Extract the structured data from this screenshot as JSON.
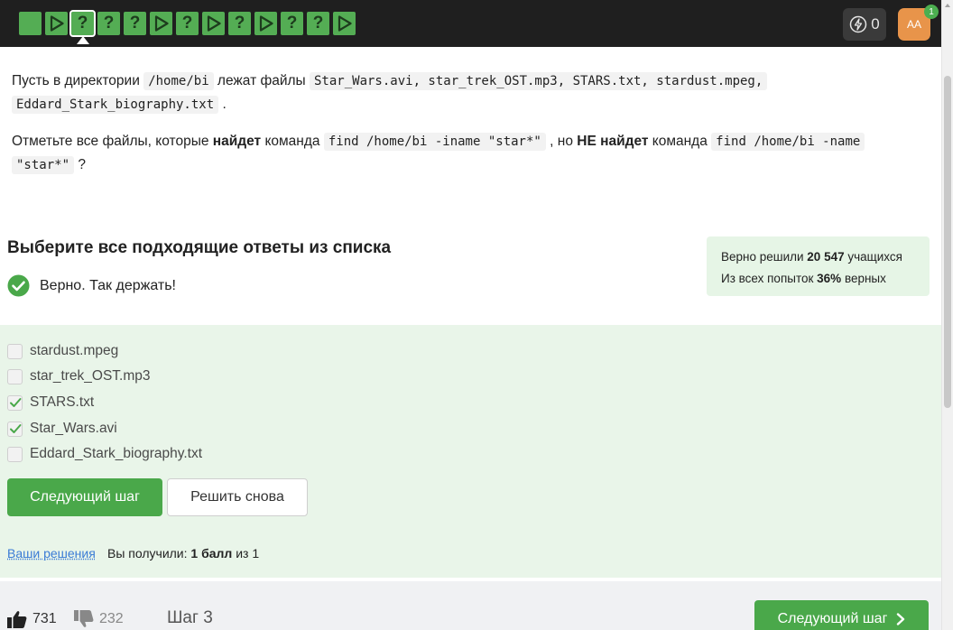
{
  "topbar": {
    "steps": [
      {
        "kind": "blank"
      },
      {
        "kind": "play"
      },
      {
        "kind": "question",
        "label": "?"
      },
      {
        "kind": "question",
        "label": "?"
      },
      {
        "kind": "question",
        "label": "?"
      },
      {
        "kind": "play"
      },
      {
        "kind": "question",
        "label": "?"
      },
      {
        "kind": "play"
      },
      {
        "kind": "question",
        "label": "?"
      },
      {
        "kind": "play"
      },
      {
        "kind": "question",
        "label": "?"
      },
      {
        "kind": "question",
        "label": "?"
      },
      {
        "kind": "play"
      }
    ],
    "current_step_index": 2,
    "energy_count": "0",
    "avatar_initials": "AA",
    "notification_count": "1",
    "step_color": "#54ad54"
  },
  "question": {
    "p1": {
      "t1": "Пусть в директории ",
      "c1": "/home/bi",
      "t2": " лежат файлы ",
      "c2": "Star_Wars.avi, star_trek_OST.mp3, STARS.txt, stardust.mpeg,",
      "c3": "Eddard_Stark_biography.txt",
      "t3": " ."
    },
    "p2": {
      "t1": "Отметьте все файлы, которые ",
      "b1": "найдет",
      "t2": " команда ",
      "c1": "find /home/bi -iname \"star*\"",
      "t3": " , но ",
      "b2": "НЕ найдет",
      "t4": " команда ",
      "c2": "find /home/bi -name",
      "c3": "\"star*\"",
      "t5": " ?"
    }
  },
  "quiz": {
    "heading": "Выберите все подходящие ответы из списка",
    "result_text": "Верно. Так держать!",
    "stats": {
      "line1_prefix": "Верно решили ",
      "line1_count": "20 547",
      "line1_suffix": " учащихся",
      "line2_prefix": "Из всех попыток ",
      "line2_percent": "36%",
      "line2_suffix": " верных"
    },
    "options": [
      {
        "label": "stardust.mpeg",
        "checked": false
      },
      {
        "label": "star_trek_OST.mp3",
        "checked": false
      },
      {
        "label": "STARS.txt",
        "checked": true
      },
      {
        "label": "Star_Wars.avi",
        "checked": true
      },
      {
        "label": "Eddard_Stark_biography.txt",
        "checked": false
      }
    ],
    "next_button": "Следующий шаг",
    "retry_button": "Решить снова",
    "your_solutions_link": "Ваши решения",
    "score_prefix": "Вы получили: ",
    "score_bold": "1 балл",
    "score_suffix": " из 1",
    "success_color": "#4aa84a"
  },
  "footer": {
    "likes": "731",
    "dislikes": "232",
    "step_label": "Шаг 3",
    "next_button": "Следующий шаг"
  }
}
